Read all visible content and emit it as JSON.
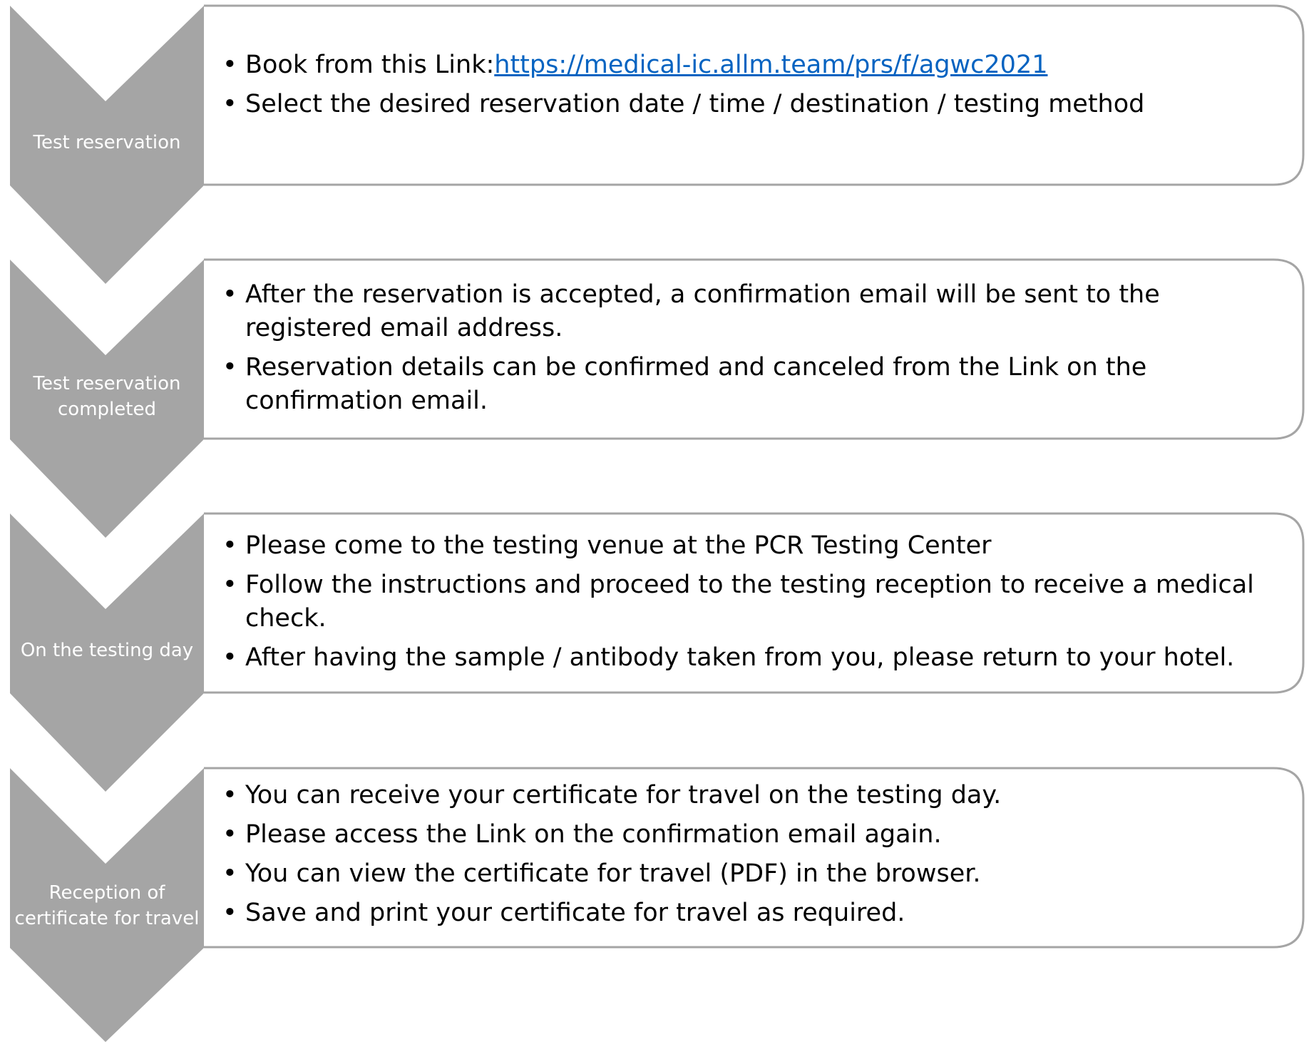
{
  "colors": {
    "chevron_fill": "#a5a5a5",
    "box_border": "#a5a5a5",
    "label_text": "#ffffff",
    "link": "#0563c1"
  },
  "steps": [
    {
      "label": "Test reservation",
      "bullets": [
        {
          "prefix": "Book from this Link:",
          "link": "https://medical-ic.allm.team/prs/f/agwc2021"
        },
        {
          "text": "Select the desired reservation date / time / destination / testing method"
        }
      ]
    },
    {
      "label": "Test reservation completed",
      "bullets": [
        {
          "text": "After the reservation is accepted, a confirmation email will be sent to the registered email address."
        },
        {
          "text": "Reservation details can be confirmed and canceled from the Link on the confirmation email."
        }
      ]
    },
    {
      "label": "On the testing day",
      "bullets": [
        {
          "text": "Please come to the testing venue at the PCR Testing Center"
        },
        {
          "text": "Follow the instructions and proceed to the testing reception to receive a medical check."
        },
        {
          "text": "After having the sample / antibody taken from you, please return to your hotel."
        }
      ]
    },
    {
      "label": "Reception of certificate for travel",
      "bullets": [
        {
          "text": "You can receive your certificate for travel on the testing day."
        },
        {
          "text": "Please access the Link on the confirmation email again."
        },
        {
          "text": "You can view the certificate for travel (PDF) in the browser."
        },
        {
          "text": "Save and print your certificate for travel as required."
        }
      ]
    }
  ]
}
